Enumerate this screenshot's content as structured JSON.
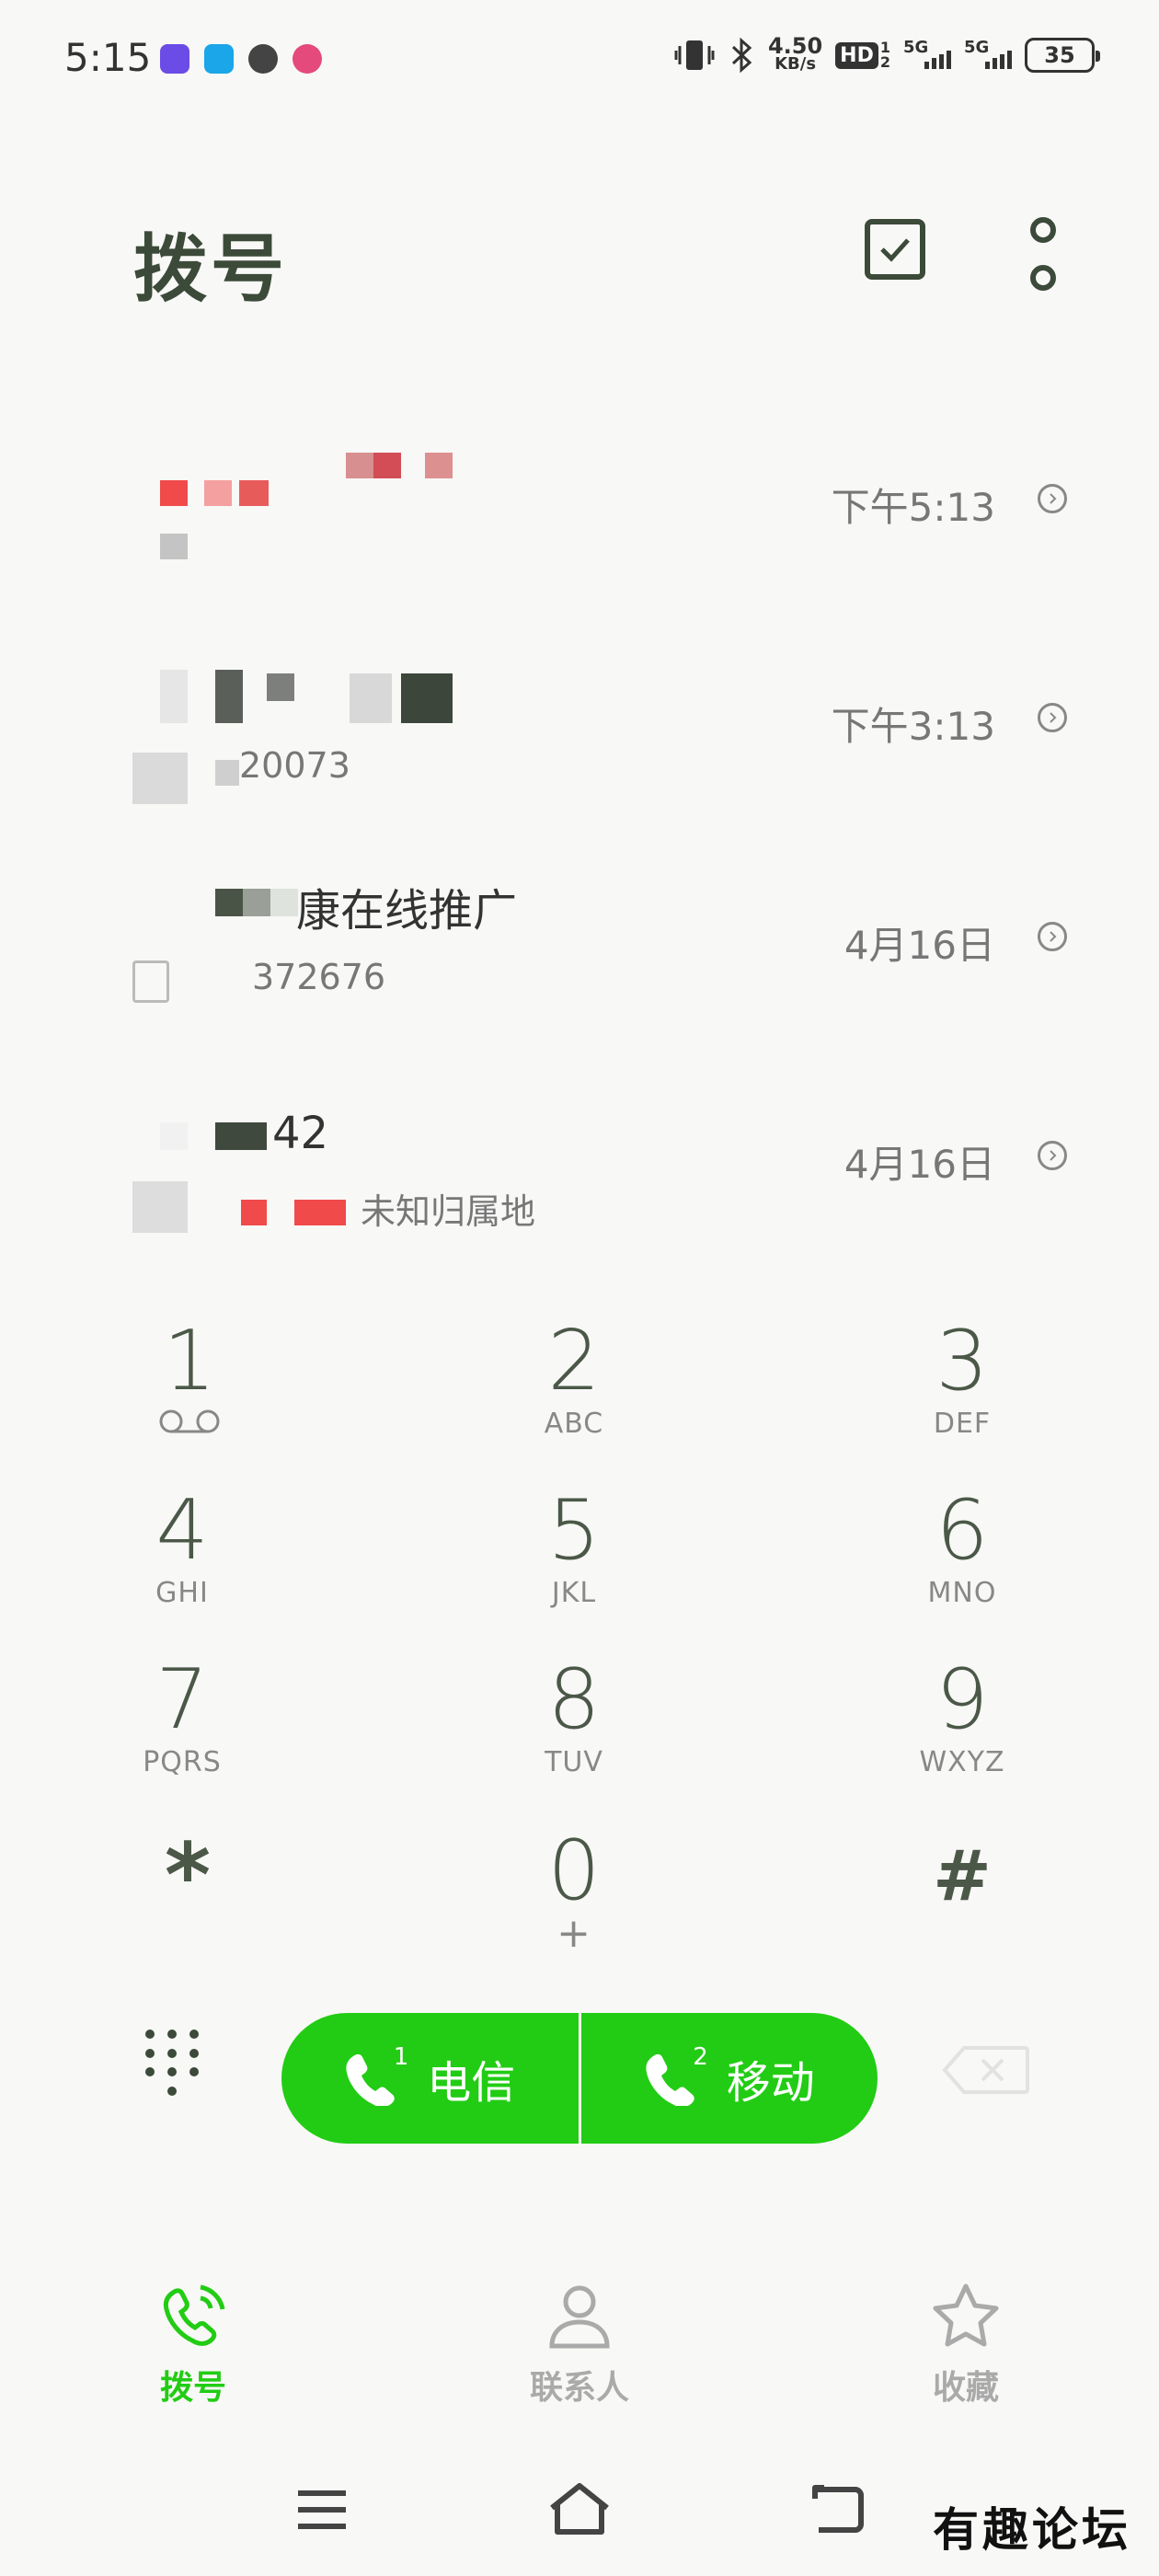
{
  "status_bar": {
    "time": "5:15",
    "net_speed_value": "4.50",
    "net_speed_unit": "KB/s",
    "hd_label": "HD",
    "hd_sub": "1",
    "hd_sub2": "2",
    "signal1_label": "5G",
    "signal2_label": "5G",
    "battery": "35"
  },
  "header": {
    "title": "拨号"
  },
  "call_log": [
    {
      "name": "",
      "sub": "",
      "time": "下午5:13"
    },
    {
      "name": "",
      "sub": "20073",
      "time": "下午3:13"
    },
    {
      "name": "康在线推广",
      "sub": "372676",
      "time": "4月16日"
    },
    {
      "name": "42",
      "sub": "未知归属地",
      "time": "4月16日"
    }
  ],
  "keypad": [
    {
      "digit": "1",
      "letters": ""
    },
    {
      "digit": "2",
      "letters": "ABC"
    },
    {
      "digit": "3",
      "letters": "DEF"
    },
    {
      "digit": "4",
      "letters": "GHI"
    },
    {
      "digit": "5",
      "letters": "JKL"
    },
    {
      "digit": "6",
      "letters": "MNO"
    },
    {
      "digit": "7",
      "letters": "PQRS"
    },
    {
      "digit": "8",
      "letters": "TUV"
    },
    {
      "digit": "9",
      "letters": "WXYZ"
    },
    {
      "digit": "*",
      "letters": ""
    },
    {
      "digit": "0",
      "letters": "+"
    },
    {
      "digit": "#",
      "letters": ""
    }
  ],
  "actions": {
    "call_sim1_label": "电信",
    "call_sim1_index": "1",
    "call_sim2_label": "移动",
    "call_sim2_index": "2"
  },
  "bottom_nav": {
    "dial": "拨号",
    "contacts": "联系人",
    "favorites": "收藏"
  },
  "watermark": "有趣论坛",
  "colors": {
    "accent_green": "#22cc14",
    "text_dark_green": "#3c4a39",
    "inactive_gray": "#aaaaaa"
  }
}
